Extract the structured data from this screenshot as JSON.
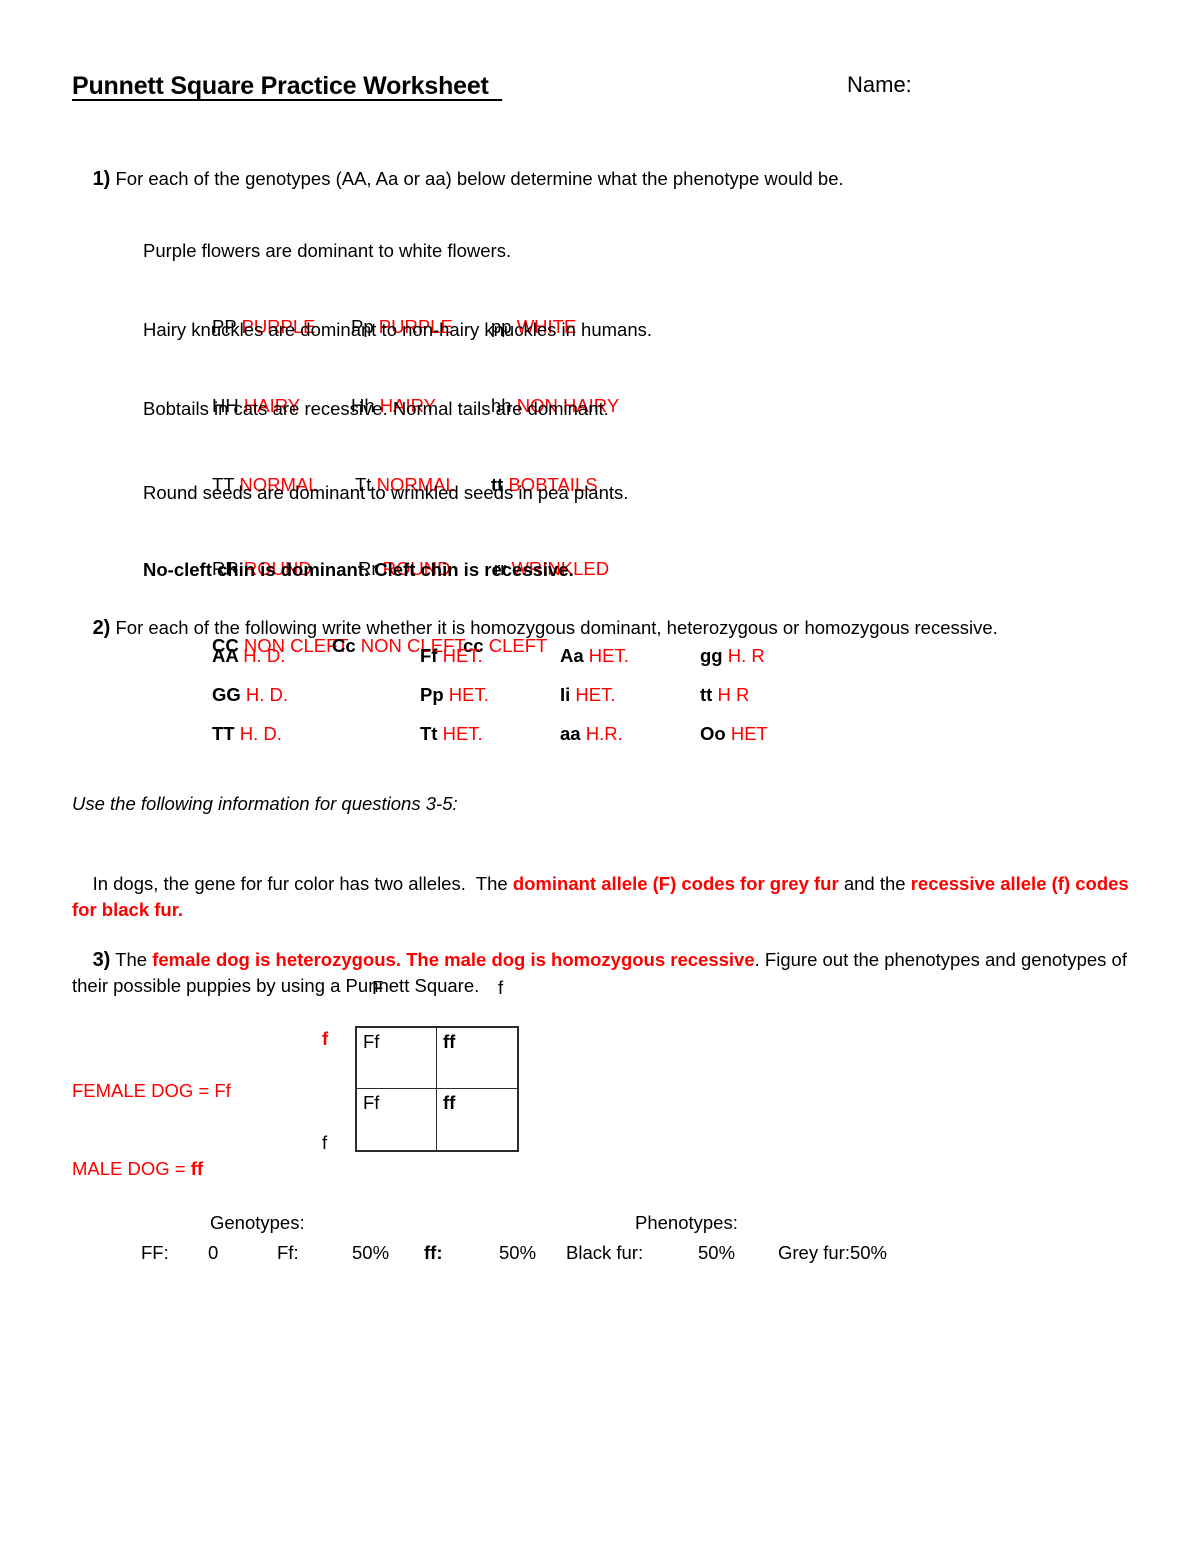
{
  "header": {
    "title": "Punnett Square Practice Worksheet  ",
    "name_label": "Name:"
  },
  "colors": {
    "answer_red": "#ff0000",
    "text_black": "#000000",
    "border": "#2b2b2b"
  },
  "q1": {
    "number": "1)",
    "prompt": " For each of the genotypes (AA, Aa or aa) below determine what the phenotype would be.",
    "traits": [
      {
        "prompt": "Purple flowers are dominant to white flowers.",
        "items": [
          {
            "genotype": "PP ",
            "answer": "PURPLE"
          },
          {
            "genotype": "Pp ",
            "answer": "PURPLE"
          },
          {
            "genotype": "pp ",
            "answer": "WHITE"
          }
        ]
      },
      {
        "prompt": "Hairy knuckles are dominant to non-hairy knuckles in humans.",
        "items": [
          {
            "genotype": "HH ",
            "answer": "HAIRY"
          },
          {
            "genotype": "Hh ",
            "answer": "HAIRY"
          },
          {
            "genotype": "hh ",
            "answer": "NON HAIRY"
          }
        ]
      },
      {
        "prompt": "Bobtails in cats are recessive. Normal tails are dominant.",
        "items": [
          {
            "genotype": "TT ",
            "answer": "NORMAL"
          },
          {
            "genotype": "Tt ",
            "answer": "NORMAL"
          },
          {
            "genotype": "tt ",
            "answer": "BOBTAILS"
          }
        ]
      },
      {
        "prompt": "Round seeds are dominant to wrinkled seeds in pea plants.",
        "items": [
          {
            "genotype": "RR ",
            "answer": "ROUND"
          },
          {
            "genotype": "Rr ",
            "answer": "ROUND"
          },
          {
            "genotype": "rr ",
            "answer": "WRINKLED"
          }
        ]
      },
      {
        "prompt": "No-cleft chin is dominant. Cleft chin is recessive.",
        "items": [
          {
            "genotype": "CC ",
            "answer": "NON CLEFT"
          },
          {
            "genotype": "Cc ",
            "answer": "NON CLEFT"
          },
          {
            "genotype": "cc ",
            "answer": "CLEFT"
          }
        ]
      }
    ]
  },
  "q2": {
    "number": "2)",
    "prompt": " For each of the following write whether it is homozygous dominant, heterozygous or homozygous recessive.",
    "rows": [
      [
        {
          "genotype": "AA ",
          "answer": "H. D."
        },
        {
          "genotype": "Ff ",
          "answer": "HET."
        },
        {
          "genotype": "Aa ",
          "answer": "HET."
        },
        {
          "genotype": "gg ",
          "answer": "H. R"
        }
      ],
      [
        {
          "genotype": "GG ",
          "answer": "H. D."
        },
        {
          "genotype": "Pp ",
          "answer": "HET."
        },
        {
          "genotype": "Ii ",
          "answer": "HET."
        },
        {
          "genotype": "tt ",
          "answer": "H R"
        }
      ],
      [
        {
          "genotype": "TT ",
          "answer": "H. D."
        },
        {
          "genotype": "Tt ",
          "answer": "HET."
        },
        {
          "genotype": "aa ",
          "answer": "H.R."
        },
        {
          "genotype": "Oo ",
          "answer": "HET"
        }
      ]
    ]
  },
  "info": {
    "heading": "Use the following information for questions 3-5:",
    "body_part1": "In dogs, the gene for fur color has two alleles.  The ",
    "body_red1": "dominant allele (F) codes for grey fur",
    "body_part2": " and the ",
    "body_red2": "recessive allele (f) codes for black fur."
  },
  "q3": {
    "number": "3)",
    "text_part1": " The ",
    "text_red": "female dog is heterozygous. The male dog is homozygous recessive",
    "text_part2": ". Figure out the phenotypes and genotypes of their possible puppies by using a Punnett Square."
  },
  "punnett": {
    "top_labels": [
      "F",
      "f"
    ],
    "side_labels": [
      "f",
      "f"
    ],
    "cells": [
      "Ff",
      "ff",
      "Ff",
      "ff"
    ],
    "female_parent": "FEMALE DOG = Ff",
    "male_parent_prefix": "MALE DOG = ",
    "male_parent_genotype": "ff"
  },
  "results": {
    "genotypes_header": "Genotypes:",
    "phenotypes_header": "Phenotypes:",
    "genotypes": [
      {
        "label": "FF:",
        "value": "0"
      },
      {
        "label": "Ff:",
        "value": "50%"
      },
      {
        "label": "ff:",
        "value": "50%"
      }
    ],
    "phenotypes": [
      {
        "label": "Black fur:",
        "value": "50%"
      },
      {
        "label": "Grey fur:50%",
        "value": ""
      }
    ]
  }
}
